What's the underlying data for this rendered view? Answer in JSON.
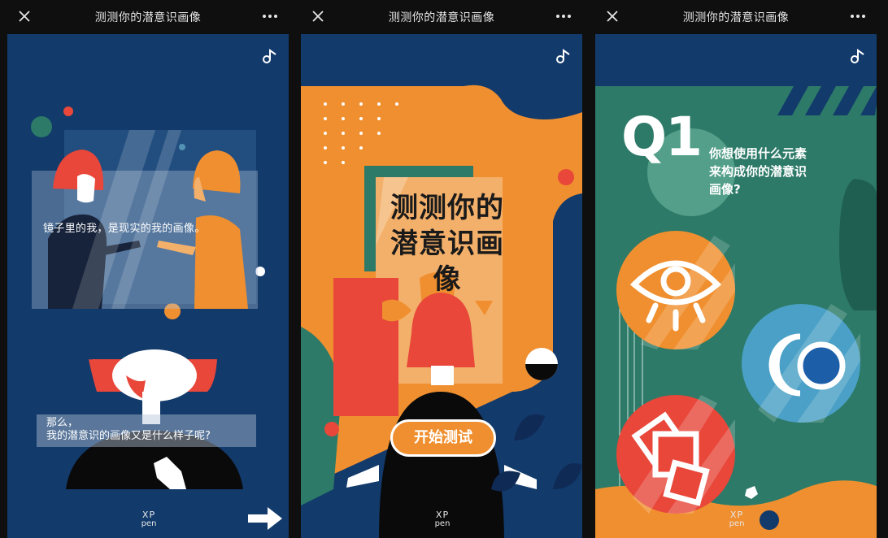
{
  "screens": [
    {
      "title": "测测你的潜意识画像",
      "line1": "镜子里的我，是现实的我的画像。",
      "line2a": "那么，",
      "line2b": "我的潜意识的画像又是什么样子呢?",
      "logo_top": "XP",
      "logo_bottom": "pen"
    },
    {
      "title": "测测你的潜意识画像",
      "heading_1": "测测你的",
      "heading_2": "潜意识画像",
      "start_button": "开始测试",
      "logo_top": "XP",
      "logo_bottom": "pen"
    },
    {
      "title": "测测你的潜意识画像",
      "question_number": "Q1",
      "question_line1": "你想使用什么元素",
      "question_line2": "来构成你的潜意识",
      "question_line3": "画像?",
      "logo_top": "XP",
      "logo_bottom": "pen"
    }
  ],
  "icons": {
    "close": "close-icon",
    "more": "more-icon",
    "music": "music-note-icon",
    "next": "arrow-right-icon",
    "eye": "eye-icon",
    "moon": "crescent-moon-icon",
    "squares": "squares-icon"
  },
  "colors": {
    "navy": "#123a6b",
    "orange": "#f08f2f",
    "teal": "#2d7a68",
    "red": "#e8473a"
  }
}
